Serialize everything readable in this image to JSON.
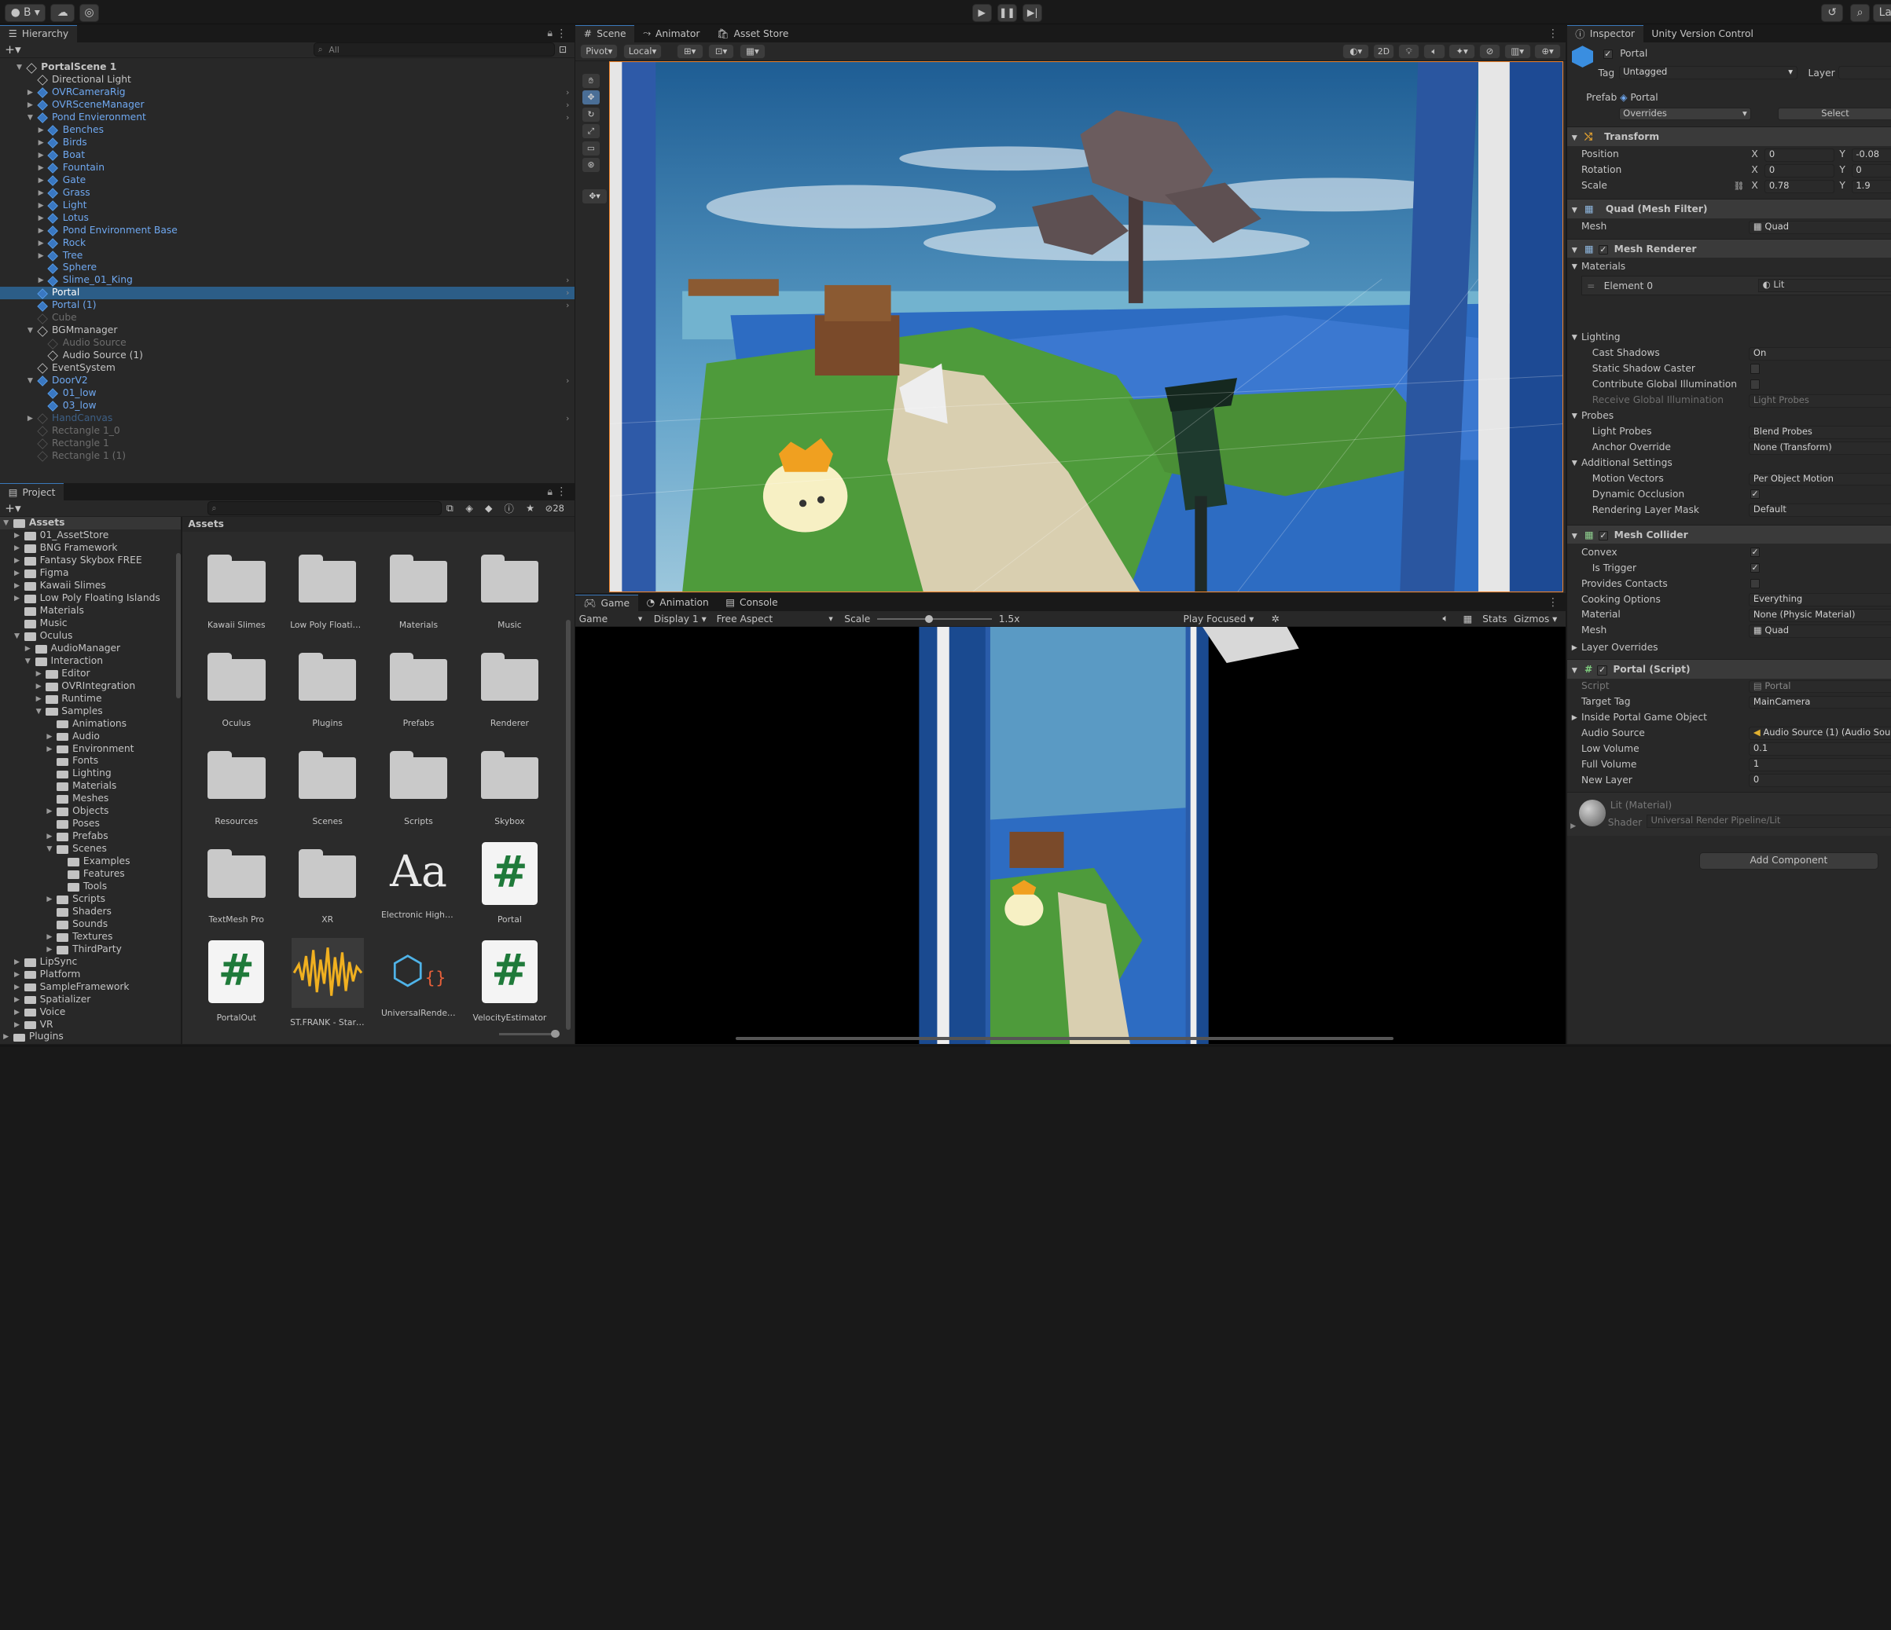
{
  "toolbar": {
    "account_label": "B",
    "right_label": "La"
  },
  "hierarchy": {
    "tab": "Hierarchy",
    "search_placeholder": "All",
    "items": [
      {
        "label": "PortalScene 1",
        "depth": 0,
        "fold": "down",
        "style": "root"
      },
      {
        "label": "Directional Light",
        "depth": 1,
        "fold": "",
        "style": "normal"
      },
      {
        "label": "OVRCameraRig",
        "depth": 1,
        "fold": "right",
        "style": "blue",
        "arrow": true
      },
      {
        "label": "OVRSceneManager",
        "depth": 1,
        "fold": "right",
        "style": "blue",
        "arrow": true
      },
      {
        "label": "Pond Envieronment",
        "depth": 1,
        "fold": "down",
        "style": "blue",
        "arrow": true
      },
      {
        "label": "Benches",
        "depth": 2,
        "fold": "right",
        "style": "blue"
      },
      {
        "label": "Birds",
        "depth": 2,
        "fold": "right",
        "style": "blue"
      },
      {
        "label": "Boat",
        "depth": 2,
        "fold": "right",
        "style": "blue"
      },
      {
        "label": "Fountain",
        "depth": 2,
        "fold": "right",
        "style": "blue"
      },
      {
        "label": "Gate",
        "depth": 2,
        "fold": "right",
        "style": "blue"
      },
      {
        "label": "Grass",
        "depth": 2,
        "fold": "right",
        "style": "blue"
      },
      {
        "label": "Light",
        "depth": 2,
        "fold": "right",
        "style": "blue"
      },
      {
        "label": "Lotus",
        "depth": 2,
        "fold": "right",
        "style": "blue"
      },
      {
        "label": "Pond Environment Base",
        "depth": 2,
        "fold": "right",
        "style": "blue"
      },
      {
        "label": "Rock",
        "depth": 2,
        "fold": "right",
        "style": "blue"
      },
      {
        "label": "Tree",
        "depth": 2,
        "fold": "right",
        "style": "blue"
      },
      {
        "label": "Sphere",
        "depth": 2,
        "fold": "",
        "style": "blue"
      },
      {
        "label": "Slime_01_King",
        "depth": 2,
        "fold": "right",
        "style": "blue",
        "arrow": true
      },
      {
        "label": "Portal",
        "depth": 1,
        "fold": "",
        "style": "selected",
        "arrow": true
      },
      {
        "label": "Portal (1)",
        "depth": 1,
        "fold": "",
        "style": "blue",
        "arrow": true
      },
      {
        "label": "Cube",
        "depth": 1,
        "fold": "",
        "style": "dim"
      },
      {
        "label": "BGMmanager",
        "depth": 1,
        "fold": "down",
        "style": "normal"
      },
      {
        "label": "Audio Source",
        "depth": 2,
        "fold": "",
        "style": "dim"
      },
      {
        "label": "Audio Source (1)",
        "depth": 2,
        "fold": "",
        "style": "normal"
      },
      {
        "label": "EventSystem",
        "depth": 1,
        "fold": "",
        "style": "normal"
      },
      {
        "label": "DoorV2",
        "depth": 1,
        "fold": "down",
        "style": "blue",
        "arrow": true
      },
      {
        "label": "01_low",
        "depth": 2,
        "fold": "",
        "style": "blue"
      },
      {
        "label": "03_low",
        "depth": 2,
        "fold": "",
        "style": "blue"
      },
      {
        "label": "HandCanvas",
        "depth": 1,
        "fold": "right",
        "style": "dimblue",
        "arrow": true
      },
      {
        "label": "Rectangle 1_0",
        "depth": 1,
        "fold": "",
        "style": "dim"
      },
      {
        "label": "Rectangle 1",
        "depth": 1,
        "fold": "",
        "style": "dim"
      },
      {
        "label": "Rectangle 1 (1)",
        "depth": 1,
        "fold": "",
        "style": "dim"
      }
    ]
  },
  "project": {
    "tab": "Project",
    "count": "28",
    "breadcrumb": "Assets",
    "tree": [
      {
        "label": "Assets",
        "depth": 0,
        "fold": "down",
        "open": true
      },
      {
        "label": "01_AssetStore",
        "depth": 1,
        "fold": "right"
      },
      {
        "label": "BNG Framework",
        "depth": 1,
        "fold": "right"
      },
      {
        "label": "Fantasy Skybox FREE",
        "depth": 1,
        "fold": "right"
      },
      {
        "label": "Figma",
        "depth": 1,
        "fold": "right"
      },
      {
        "label": "Kawaii Slimes",
        "depth": 1,
        "fold": "right"
      },
      {
        "label": "Low Poly Floating Islands",
        "depth": 1,
        "fold": "right"
      },
      {
        "label": "Materials",
        "depth": 1,
        "fold": ""
      },
      {
        "label": "Music",
        "depth": 1,
        "fold": ""
      },
      {
        "label": "Oculus",
        "depth": 1,
        "fold": "down",
        "open": true
      },
      {
        "label": "AudioManager",
        "depth": 2,
        "fold": "right"
      },
      {
        "label": "Interaction",
        "depth": 2,
        "fold": "down",
        "open": true
      },
      {
        "label": "Editor",
        "depth": 3,
        "fold": "right"
      },
      {
        "label": "OVRIntegration",
        "depth": 3,
        "fold": "right"
      },
      {
        "label": "Runtime",
        "depth": 3,
        "fold": "right"
      },
      {
        "label": "Samples",
        "depth": 3,
        "fold": "down",
        "open": true
      },
      {
        "label": "Animations",
        "depth": 4,
        "fold": ""
      },
      {
        "label": "Audio",
        "depth": 4,
        "fold": "right"
      },
      {
        "label": "Environment",
        "depth": 4,
        "fold": "right"
      },
      {
        "label": "Fonts",
        "depth": 4,
        "fold": ""
      },
      {
        "label": "Lighting",
        "depth": 4,
        "fold": ""
      },
      {
        "label": "Materials",
        "depth": 4,
        "fold": ""
      },
      {
        "label": "Meshes",
        "depth": 4,
        "fold": ""
      },
      {
        "label": "Objects",
        "depth": 4,
        "fold": "right"
      },
      {
        "label": "Poses",
        "depth": 4,
        "fold": ""
      },
      {
        "label": "Prefabs",
        "depth": 4,
        "fold": "right"
      },
      {
        "label": "Scenes",
        "depth": 4,
        "fold": "down",
        "open": true
      },
      {
        "label": "Examples",
        "depth": 5,
        "fold": ""
      },
      {
        "label": "Features",
        "depth": 5,
        "fold": ""
      },
      {
        "label": "Tools",
        "depth": 5,
        "fold": ""
      },
      {
        "label": "Scripts",
        "depth": 4,
        "fold": "right"
      },
      {
        "label": "Shaders",
        "depth": 4,
        "fold": ""
      },
      {
        "label": "Sounds",
        "depth": 4,
        "fold": ""
      },
      {
        "label": "Textures",
        "depth": 4,
        "fold": "right"
      },
      {
        "label": "ThirdParty",
        "depth": 4,
        "fold": "right"
      },
      {
        "label": "LipSync",
        "depth": 1,
        "fold": "right"
      },
      {
        "label": "Platform",
        "depth": 1,
        "fold": "right"
      },
      {
        "label": "SampleFramework",
        "depth": 1,
        "fold": "right"
      },
      {
        "label": "Spatializer",
        "depth": 1,
        "fold": "right"
      },
      {
        "label": "Voice",
        "depth": 1,
        "fold": "right"
      },
      {
        "label": "VR",
        "depth": 1,
        "fold": "right"
      },
      {
        "label": "Plugins",
        "depth": 0,
        "fold": "right"
      }
    ],
    "assets": [
      {
        "label": "Kawaii Slimes",
        "kind": "folder"
      },
      {
        "label": "Low Poly Floating ...",
        "kind": "folder"
      },
      {
        "label": "Materials",
        "kind": "folder"
      },
      {
        "label": "Music",
        "kind": "folder"
      },
      {
        "label": "Oculus",
        "kind": "folder"
      },
      {
        "label": "Plugins",
        "kind": "folder"
      },
      {
        "label": "Prefabs",
        "kind": "folder"
      },
      {
        "label": "Renderer",
        "kind": "folder"
      },
      {
        "label": "Resources",
        "kind": "folder"
      },
      {
        "label": "Scenes",
        "kind": "folder"
      },
      {
        "label": "Scripts",
        "kind": "folder"
      },
      {
        "label": "Skybox",
        "kind": "folder"
      },
      {
        "label": "TextMesh Pro",
        "kind": "folder"
      },
      {
        "label": "XR",
        "kind": "folder"
      },
      {
        "label": "Electronic Highw...",
        "kind": "font",
        "glyph": "Aa"
      },
      {
        "label": "Portal",
        "kind": "script",
        "glyph": "#"
      },
      {
        "label": "PortalOut",
        "kind": "script",
        "glyph": "#"
      },
      {
        "label": "ST.FRANK - Star ...",
        "kind": "audio"
      },
      {
        "label": "UniversalRenderP...",
        "kind": "pipeline"
      },
      {
        "label": "VelocityEstimator",
        "kind": "script",
        "glyph": "#"
      }
    ]
  },
  "scene": {
    "tabs": [
      "Scene",
      "Animator",
      "Asset Store"
    ],
    "pivot": "Pivot",
    "local": "Local",
    "mode2d": "2D"
  },
  "game": {
    "tabs": [
      "Game",
      "Animation",
      "Console"
    ],
    "display_mode": "Game",
    "display": "Display 1",
    "aspect": "Free Aspect",
    "scale_label": "Scale",
    "scale_value": "1.5x",
    "scale_fraction": 0.45,
    "play_mode": "Play Focused",
    "stats": "Stats",
    "gizmos": "Gizmos"
  },
  "inspector": {
    "tabs": [
      "Inspector",
      "Unity Version Control"
    ],
    "object_name": "Portal",
    "tag_label": "Tag",
    "tag_value": "Untagged",
    "layer_label": "Layer",
    "prefab_label": "Prefab",
    "prefab_value": "Portal",
    "overrides": "Overrides",
    "select": "Select",
    "transform": {
      "title": "Transform",
      "position_label": "Position",
      "position_x": "0",
      "position_y": "-0.08",
      "rotation_label": "Rotation",
      "rotation_x": "0",
      "rotation_y": "0",
      "scale_label": "Scale",
      "scale_x": "0.78",
      "scale_y": "1.9"
    },
    "mesh_filter": {
      "title": "Quad (Mesh Filter)",
      "mesh_label": "Mesh",
      "mesh_value": "Quad"
    },
    "mesh_renderer": {
      "title": "Mesh Renderer",
      "materials_label": "Materials",
      "element0_label": "Element 0",
      "element0_value": "Lit",
      "lighting_label": "Lighting",
      "cast_shadows_label": "Cast Shadows",
      "cast_shadows_value": "On",
      "static_shadow_label": "Static Shadow Caster",
      "contribute_gi_label": "Contribute Global Illumination",
      "receive_gi_label": "Receive Global Illumination",
      "receive_gi_value": "Light Probes",
      "probes_label": "Probes",
      "light_probes_label": "Light Probes",
      "light_probes_value": "Blend Probes",
      "anchor_label": "Anchor Override",
      "anchor_value": "None (Transform)",
      "additional_label": "Additional Settings",
      "motion_label": "Motion Vectors",
      "motion_value": "Per Object Motion",
      "dynamic_occ_label": "Dynamic Occlusion",
      "rendering_mask_label": "Rendering Layer Mask",
      "rendering_mask_value": "Default"
    },
    "mesh_collider": {
      "title": "Mesh Collider",
      "convex_label": "Convex",
      "trigger_label": "Is Trigger",
      "contacts_label": "Provides Contacts",
      "cooking_label": "Cooking Options",
      "cooking_value": "Everything",
      "material_label": "Material",
      "material_value": "None (Physic Material)",
      "mesh_label": "Mesh",
      "mesh_value": "Quad",
      "layer_overrides": "Layer Overrides"
    },
    "portal_script": {
      "title": "Portal (Script)",
      "script_label": "Script",
      "script_value": "Portal",
      "target_tag_label": "Target Tag",
      "target_tag_value": "MainCamera",
      "inside_label": "Inside Portal Game Object",
      "audio_label": "Audio Source",
      "audio_value": "Audio Source (1) (Audio Sou",
      "low_vol_label": "Low Volume",
      "low_vol_value": "0.1",
      "full_vol_label": "Full Volume",
      "full_vol_value": "1",
      "new_layer_label": "New Layer",
      "new_layer_value": "0"
    },
    "material": {
      "title": "Lit (Material)",
      "shader_label": "Shader",
      "shader_value": "Universal Render Pipeline/Lit"
    },
    "add_component": "Add Component"
  },
  "colors": {
    "accent": "#3a79bb",
    "selection": "#2c5d87",
    "prefab_blue": "#6fa8f0",
    "scene_border": "#f0832a"
  }
}
